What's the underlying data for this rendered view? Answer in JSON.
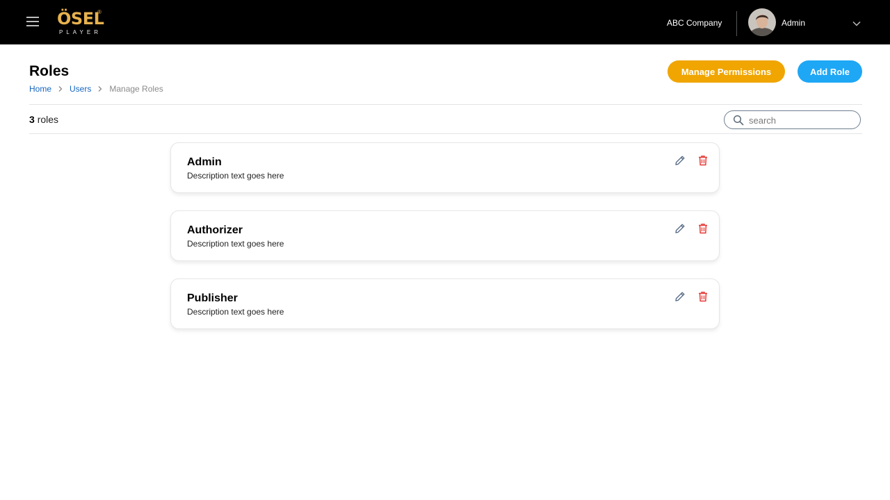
{
  "header": {
    "logo_text": "ÖSEL",
    "logo_sub": "PLAYER",
    "logo_reg": "®",
    "company": "ABC Company",
    "user_name": "Admin"
  },
  "page": {
    "title": "Roles",
    "breadcrumb": [
      {
        "label": "Home"
      },
      {
        "label": "Users"
      },
      {
        "label": "Manage Roles"
      }
    ],
    "manage_permissions_label": "Manage Permissions",
    "add_role_label": "Add Role",
    "count_number": "3",
    "count_label": "roles",
    "search_placeholder": "search"
  },
  "roles": [
    {
      "name": "Admin",
      "description": "Description text goes here"
    },
    {
      "name": "Authorizer",
      "description": "Description text goes here"
    },
    {
      "name": "Publisher",
      "description": "Description text goes here"
    }
  ],
  "colors": {
    "topbar": "#000000",
    "brand_gold": "#e7b24e",
    "manage_button": "#f0a500",
    "add_button": "#1ea7f5",
    "link": "#1565c0",
    "delete": "#e53935",
    "edit": "#5b6f8a"
  },
  "icons": {
    "menu": "hamburger-icon",
    "user_menu": "chevron-down-icon",
    "breadcrumb_separator": "chevron-right-icon",
    "search": "search-icon",
    "edit": "pencil-icon",
    "delete": "trash-icon"
  }
}
